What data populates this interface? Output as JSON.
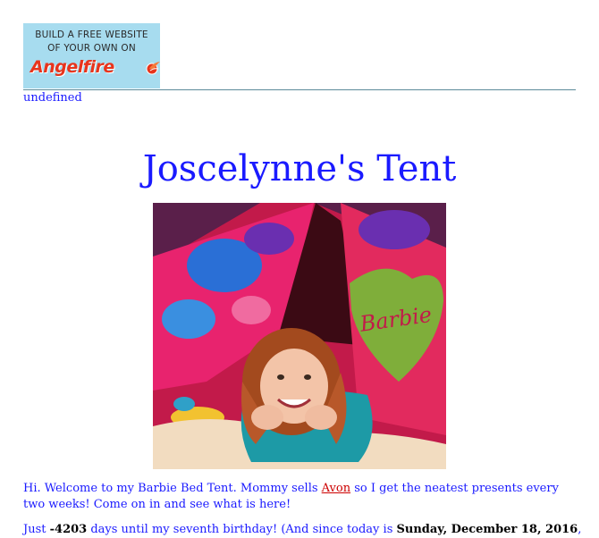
{
  "banner": {
    "line1": "BUILD A FREE WEBSITE",
    "line2": "OF YOUR OWN ON",
    "brand": "Angelfire"
  },
  "undefined_link": "undefined",
  "page_title": "Joscelynne's Tent",
  "photo": {
    "description_icon": "photo-girl-in-barbie-tent",
    "tent_text": "Barbie"
  },
  "welcome": {
    "before_link": "Hi. Welcome to my Barbie Bed Tent. Mommy sells ",
    "link_text": "Avon",
    "after_link": " so I get the neatest presents every two weeks! Come on in and see what is here!"
  },
  "countdown": {
    "prefix": "Just ",
    "days": "-4203",
    "middle": " days until my seventh birthday! (And since today is ",
    "date": "Sunday, December 18, 2016",
    "suffix": ","
  },
  "colors": {
    "text": "#1a1aff",
    "link": "#cc0000",
    "banner_bg": "#a7dcef",
    "brand": "#e8341c"
  }
}
